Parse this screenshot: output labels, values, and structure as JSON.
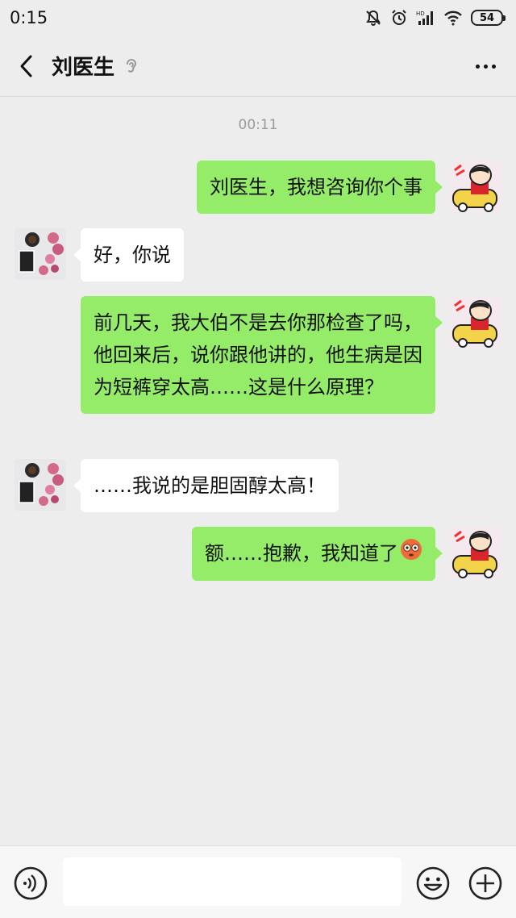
{
  "status_bar": {
    "time": "0:15",
    "battery": "54",
    "icons": [
      "mute-bell-icon",
      "alarm-icon",
      "signal-icon",
      "wifi-icon",
      "battery-icon"
    ]
  },
  "nav": {
    "title": "刘医生",
    "back_icon": "chevron-left-icon",
    "ear_icon": "ear-icon",
    "more_icon": "more-dots-icon"
  },
  "chat": {
    "timestamp": "00:11",
    "messages": [
      {
        "side": "right",
        "text": "刘医生，我想咨询你个事"
      },
      {
        "side": "left",
        "text": "好，你说"
      },
      {
        "side": "right",
        "text": "前几天，我大伯不是去你那检查了吗，他回来后，说你跟他讲的，他生病是因为短裤穿太高……这是什么原理？"
      },
      {
        "side": "left",
        "text": "……我说的是胆固醇太高！"
      },
      {
        "side": "right",
        "text": "额……抱歉，我知道了",
        "emoji": "flushed-face-icon"
      }
    ]
  },
  "input_bar": {
    "voice_icon": "voice-icon",
    "text_value": "",
    "emoji_icon": "smile-icon",
    "plus_icon": "plus-icon"
  },
  "colors": {
    "background": "#ededed",
    "sent_bubble": "#95ec69",
    "received_bubble": "#ffffff",
    "timestamp": "#9b9b9b"
  }
}
